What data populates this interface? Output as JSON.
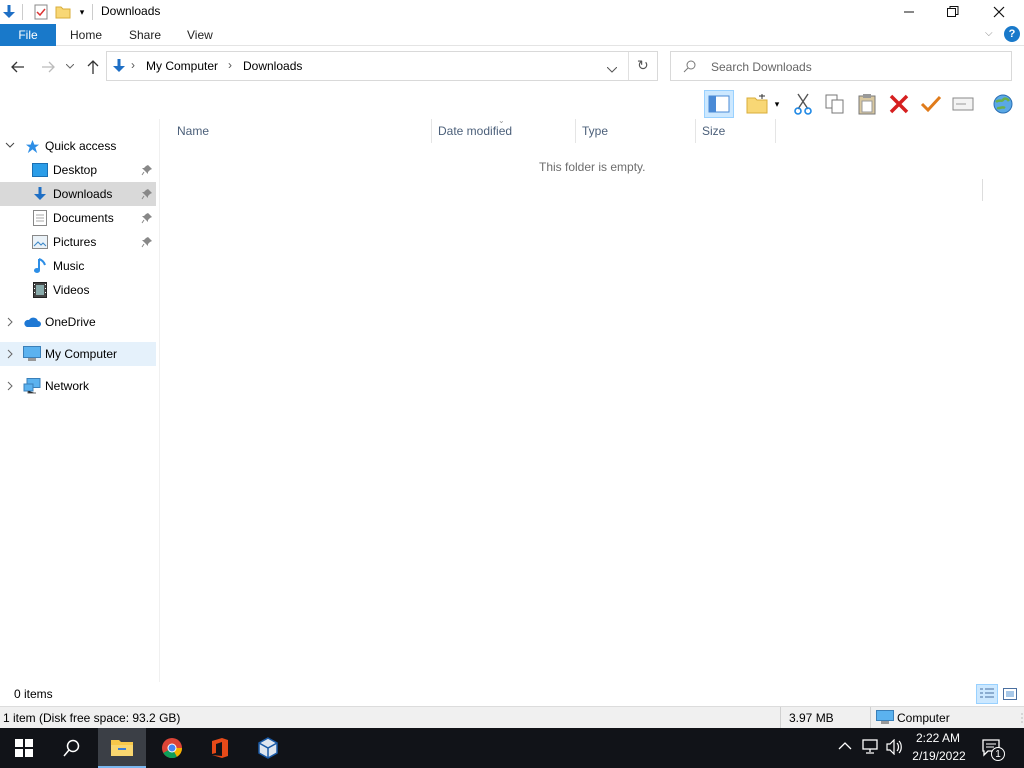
{
  "window": {
    "title": "Downloads"
  },
  "ribbon": {
    "tabs": [
      {
        "label": "File"
      },
      {
        "label": "Home"
      },
      {
        "label": "Share"
      },
      {
        "label": "View"
      }
    ]
  },
  "address": {
    "breadcrumb": [
      "My Computer",
      "Downloads"
    ],
    "search_placeholder": "Search Downloads"
  },
  "nav": {
    "quick_access": "Quick access",
    "quick_items": [
      {
        "label": "Desktop",
        "icon": "desktop-icon",
        "pinned": true
      },
      {
        "label": "Downloads",
        "icon": "downloads-icon",
        "pinned": true,
        "selected": true
      },
      {
        "label": "Documents",
        "icon": "documents-icon",
        "pinned": true
      },
      {
        "label": "Pictures",
        "icon": "pictures-icon",
        "pinned": true
      },
      {
        "label": "Music",
        "icon": "music-icon",
        "pinned": false
      },
      {
        "label": "Videos",
        "icon": "videos-icon",
        "pinned": false
      }
    ],
    "onedrive": "OneDrive",
    "my_computer": "My Computer",
    "network": "Network"
  },
  "list": {
    "columns": [
      "Name",
      "Date modified",
      "Type",
      "Size"
    ],
    "empty_message": "This folder is empty."
  },
  "status": {
    "item_count": "0 items",
    "disk_info": "1 item (Disk free space: 93.2 GB)",
    "size": "3.97 MB",
    "location": "Computer"
  },
  "taskbar": {
    "time": "2:22 AM",
    "date": "2/19/2022",
    "notification_count": "1"
  },
  "colors": {
    "accent": "#1979ca",
    "selection": "#cce8ff",
    "taskbar": "#111318"
  }
}
